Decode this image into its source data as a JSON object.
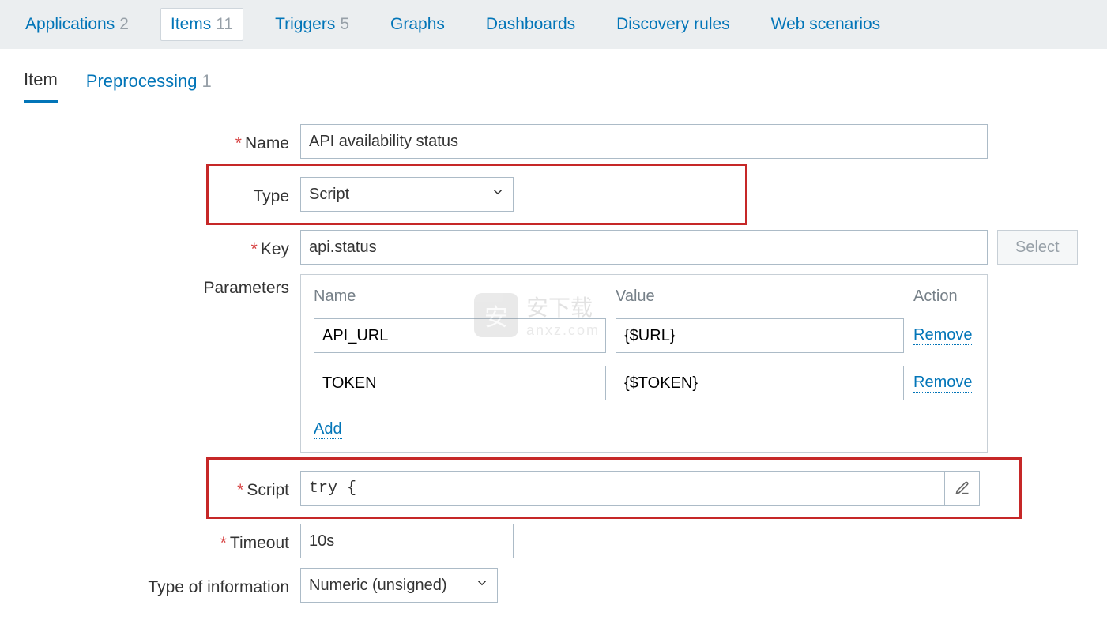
{
  "top_tabs": [
    {
      "label": "Applications",
      "count": "2"
    },
    {
      "label": "Items",
      "count": "11"
    },
    {
      "label": "Triggers",
      "count": "5"
    },
    {
      "label": "Graphs",
      "count": ""
    },
    {
      "label": "Dashboards",
      "count": ""
    },
    {
      "label": "Discovery rules",
      "count": ""
    },
    {
      "label": "Web scenarios",
      "count": ""
    }
  ],
  "sub_tabs": [
    {
      "label": "Item",
      "count": ""
    },
    {
      "label": "Preprocessing",
      "count": "1"
    }
  ],
  "form": {
    "name_label": "Name",
    "name_value": "API availability status",
    "type_label": "Type",
    "type_value": "Script",
    "key_label": "Key",
    "key_value": "api.status",
    "select_button": "Select",
    "parameters_label": "Parameters",
    "params_header": {
      "name": "Name",
      "value": "Value",
      "action": "Action"
    },
    "params": [
      {
        "name": "API_URL",
        "value": "{$URL}",
        "remove": "Remove"
      },
      {
        "name": "TOKEN",
        "value": "{$TOKEN}",
        "remove": "Remove"
      }
    ],
    "add_label": "Add",
    "script_label": "Script",
    "script_value": "try {",
    "timeout_label": "Timeout",
    "timeout_value": "10s",
    "typeinfo_label": "Type of information",
    "typeinfo_value": "Numeric (unsigned)"
  },
  "watermark": {
    "main": "安下载",
    "sub": "anxz.com"
  }
}
